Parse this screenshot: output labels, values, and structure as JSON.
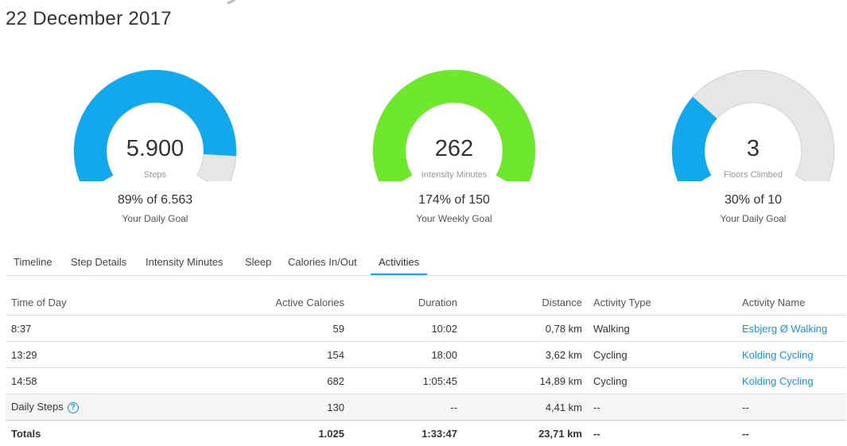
{
  "header": {
    "date": "22 December 2017"
  },
  "gauges": [
    {
      "value": "5.900",
      "label": "Steps",
      "pct_text": "89% of 6.563",
      "goal": "Your Daily Goal",
      "fraction": 0.89,
      "color": "#11a9ed"
    },
    {
      "value": "262",
      "label": "Intensity Minutes",
      "pct_text": "174% of 150",
      "goal": "Your Weekly Goal",
      "fraction": 1.0,
      "color": "#6ee82a"
    },
    {
      "value": "3",
      "label": "Floors Climbed",
      "pct_text": "30% of 10",
      "goal": "Your Daily Goal",
      "fraction": 0.3,
      "color": "#11a9ed"
    }
  ],
  "gauge_bg_color": "#e6e6e6",
  "tabs": [
    "Timeline",
    "Step Details",
    "Intensity Minutes",
    "Sleep",
    "Calories In/Out",
    "Activities"
  ],
  "active_tab": "Activities",
  "table": {
    "headers": [
      "Time of Day",
      "Active Calories",
      "Duration",
      "Distance",
      "Activity Type",
      "Activity Name"
    ],
    "rows": [
      [
        "8:37",
        "59",
        "10:02",
        "0,78 km",
        "Walking",
        "Esbjerg Ø Walking"
      ],
      [
        "13:29",
        "154",
        "18:00",
        "3,62 km",
        "Cycling",
        "Kolding Cycling"
      ],
      [
        "14:58",
        "682",
        "1:05:45",
        "14,89 km",
        "Cycling",
        "Kolding Cycling"
      ]
    ],
    "daily_steps": [
      "Daily Steps",
      "130",
      "--",
      "4,41 km",
      "--",
      "--"
    ],
    "help_icon": "?",
    "totals": [
      "Totals",
      "1.025",
      "1:33:47",
      "23,71 km",
      "--",
      "--"
    ]
  }
}
